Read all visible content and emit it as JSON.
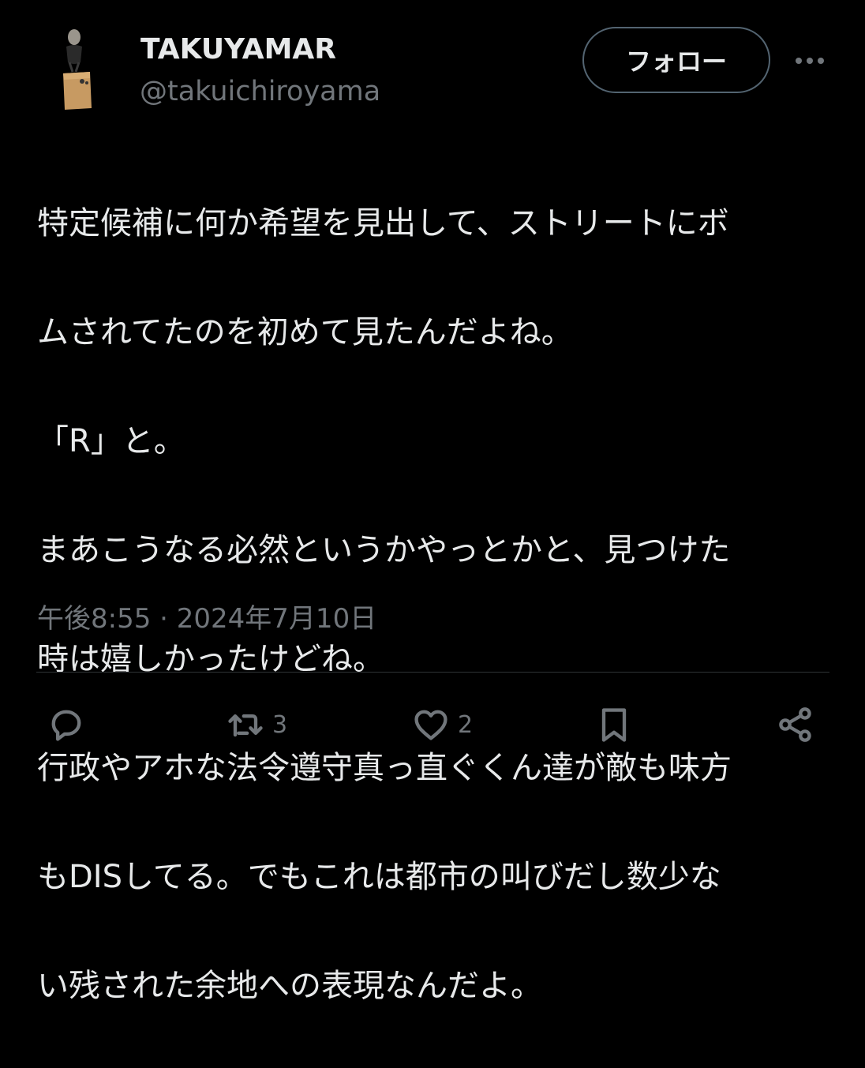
{
  "author": {
    "display_name": "TAKUYAMAR",
    "handle": "@takuichiroyama"
  },
  "header": {
    "follow_label": "フォロー",
    "more_icon": "more-horizontal-icon"
  },
  "tweet": {
    "lines": [
      "特定候補に何か希望を見出して、ストリートにボ",
      "ムされてたのを初めて見たんだよね。",
      "「R」と。",
      "まあこうなる必然というかやっとかと、見つけた",
      "時は嬉しかったけどね。",
      "行政やアホな法令遵守真っ直ぐくん達が敵も味方",
      "もDISしてる。でもこれは都市の叫びだし数少な",
      "い残された余地への表現なんだよ。"
    ],
    "timestamp": "午後8:55 · 2024年7月10日"
  },
  "actions": {
    "reply_icon": "reply-icon",
    "retweet_icon": "retweet-icon",
    "retweet_count": "3",
    "like_icon": "heart-icon",
    "like_count": "2",
    "bookmark_icon": "bookmark-icon",
    "share_icon": "share-icon"
  },
  "colors": {
    "background": "#000000",
    "text": "#e7e9ea",
    "secondary": "#71767b",
    "border": "#2f3336"
  }
}
